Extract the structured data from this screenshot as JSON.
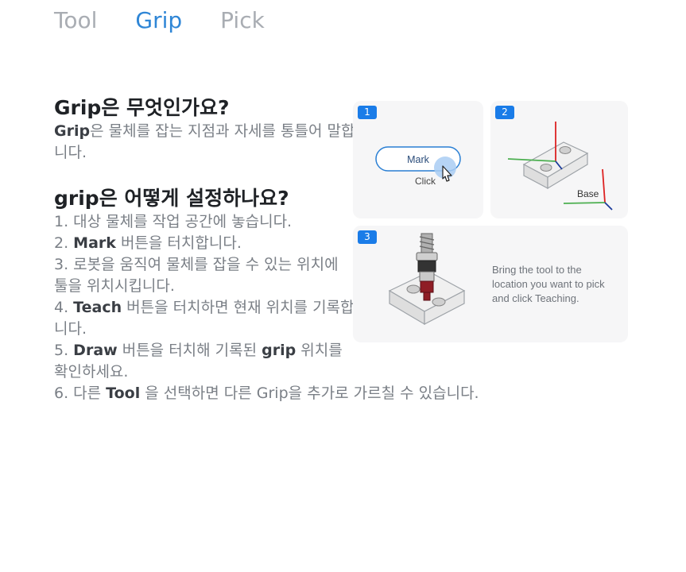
{
  "tabs": [
    {
      "label": "Tool",
      "active": false
    },
    {
      "label": "Grip",
      "active": true
    },
    {
      "label": "Pick",
      "active": false
    }
  ],
  "section1": {
    "title_bold": "Grip",
    "title_rest": "은 무엇인가요?",
    "body_bold": "Grip",
    "body_rest": "은 물체를 잡는 지점과 자세를 통틀어 말합니다."
  },
  "section2": {
    "title": "grip은 어떻게 설정하나요?",
    "steps": [
      {
        "pre": "1. 대상 물체를 작업 공간에 놓습니다.",
        "bold": "",
        "post": ""
      },
      {
        "pre": "2. ",
        "bold": "Mark",
        "post": " 버튼을 터치합니다."
      },
      {
        "pre": "3. 로봇을 움직여 물체를 잡을 수 있는 위치에 툴을 위치시킵니다.",
        "bold": "",
        "post": ""
      },
      {
        "pre": "4. ",
        "bold": "Teach",
        "post": " 버튼을 터치하면 현재 위치를 기록합니다."
      },
      {
        "pre": "5. ",
        "bold": "Draw",
        "post": " 버튼을 터치해 기록된 ",
        "bold2": "grip",
        "post2": " 위치를 확인하세요."
      },
      {
        "pre": "6. 다른 ",
        "bold": "Tool",
        "post": " 을 선택하면 다른 Grip을 추가로 가르칠 수 있습니다."
      }
    ]
  },
  "illustration": {
    "panel1": {
      "badge": "1",
      "button_label": "Mark",
      "click_label": "Click"
    },
    "panel2": {
      "badge": "2",
      "base_label": "Base"
    },
    "panel3": {
      "badge": "3",
      "caption_lines": [
        "Bring the tool to the",
        "location you want to pick",
        "and click Teaching."
      ]
    }
  },
  "colors": {
    "accent": "#2f86d6",
    "badge": "#1a7ce8",
    "panel_bg": "#f6f6f7"
  }
}
